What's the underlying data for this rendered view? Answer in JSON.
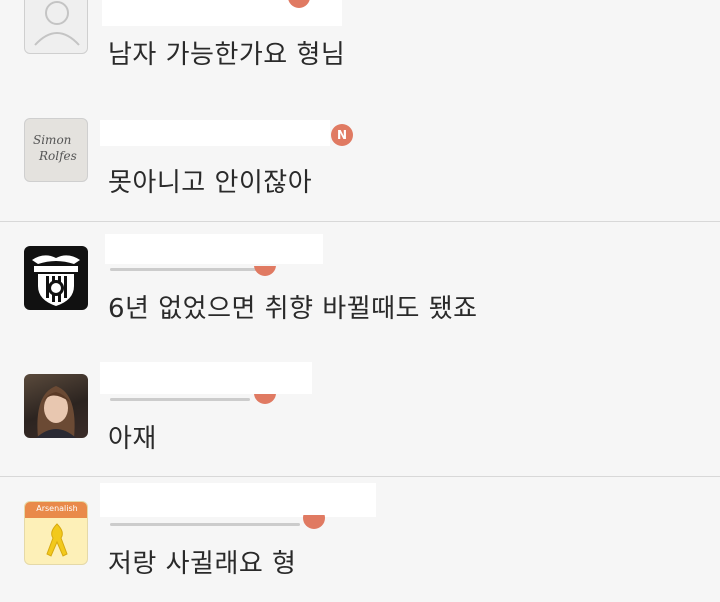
{
  "comments": [
    {
      "avatar": "default-person-avatar",
      "text": "남자 가능한가요 형님"
    },
    {
      "avatar": "signature-avatar",
      "avatar_text": [
        "Simon",
        "Rolfes"
      ],
      "badge": "N",
      "text": "못아니고 안이잖아"
    },
    {
      "avatar": "valencia-crest-avatar",
      "text": "6년 없었으면 취향 바뀔때도 됐죠"
    },
    {
      "avatar": "photo-avatar",
      "text": "아재"
    },
    {
      "avatar": "arsenalish-ribbon-avatar",
      "avatar_text": [
        "Arsenalish"
      ],
      "text": "저랑 사귈래요 형"
    }
  ],
  "colors": {
    "badge": "#e07a62",
    "background": "#f6f6f6",
    "text": "#2a2a2a"
  }
}
